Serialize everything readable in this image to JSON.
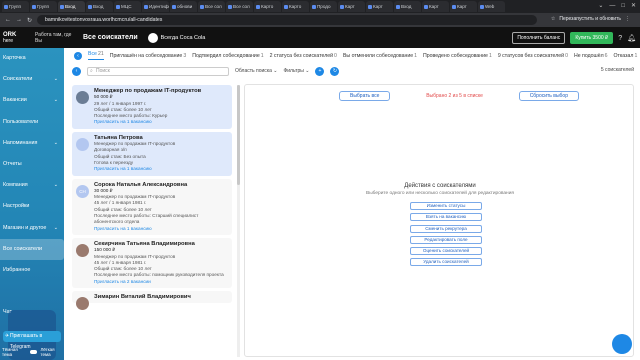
{
  "browser": {
    "tabs": [
      "Групп",
      "Групп",
      "Вход",
      "Вход",
      "МЦС",
      "Идентифи",
      "обнови",
      "Все сол",
      "Все сол",
      "Карто",
      "Карто",
      "Продо",
      "Карт",
      "Карт",
      "Вход",
      "Карт",
      "Карт",
      "Web"
    ],
    "url": "bamnikovitestonvosraua.worlhcmcru/all-candidates",
    "extension_text": "Перезапустить и обновить"
  },
  "appbar": {
    "logo": "ORK",
    "logo_sub": "here",
    "work_status": "Работа там, где Вы",
    "page_title": "Все соискатели",
    "company": "Всегда Coca Cola",
    "replenish": "Пополнить баланс",
    "buy": "Купить 3500 ₽"
  },
  "sidebar": {
    "items": [
      {
        "label": "Карточка",
        "chevron": ""
      },
      {
        "label": "Соискатели",
        "chevron": "⌄"
      },
      {
        "label": "Вакансии",
        "chevron": "⌄"
      },
      {
        "label": "Пользователи",
        "chevron": ""
      },
      {
        "label": "Напоминания",
        "chevron": "⌄"
      },
      {
        "label": "Отчеты",
        "chevron": ""
      },
      {
        "label": "Компания",
        "chevron": "⌄"
      },
      {
        "label": "Настройки",
        "chevron": ""
      },
      {
        "label": "Магазин и другое",
        "chevron": "⌄"
      },
      {
        "label": "Все соискатели",
        "chevron": ""
      },
      {
        "label": "Избранное",
        "chevron": ""
      },
      {
        "label": "",
        "chevron": ""
      },
      {
        "label": "Чат",
        "chevron": ""
      }
    ],
    "telegram": "Приглашать в Telegram",
    "toggle_left": "Тёмная тема",
    "toggle_right": "Лёгкая тема"
  },
  "stages": [
    {
      "label": "Все",
      "count": "21"
    },
    {
      "label": "Приглашён на собеседование",
      "count": "3"
    },
    {
      "label": "Подтвердил собеседование",
      "count": "1"
    },
    {
      "label": "2 статуса без соискателей",
      "count": "0"
    },
    {
      "label": "Вы отменили собеседование",
      "count": "1"
    },
    {
      "label": "Проведено собеседование",
      "count": "1"
    },
    {
      "label": "9 статусов без соискателей",
      "count": "0"
    },
    {
      "label": "Не подошёл",
      "count": "6"
    },
    {
      "label": "Отказал",
      "count": "1"
    }
  ],
  "filters": {
    "search_placeholder": "Поиск",
    "search_area": "Область поиска ⌄",
    "filters": "Фильтры ⌄",
    "count": "5 соискателей"
  },
  "candidates": [
    {
      "initials": "",
      "name": "Менеджер по продажам IT-продуктов",
      "salary": "50 000 ₽",
      "vacancy": "",
      "l1": "29 лет / 1 января 1997 г.",
      "l2": "Общий стаж: более 10 лет",
      "l3": "Последнее место работы: Курьер",
      "l4": "",
      "link": "Пригласить на 1 вакансию"
    },
    {
      "initials": "",
      "name": "Татьяна Петрова",
      "salary": "",
      "vacancy": "Менеджер по продажам IT-продуктов",
      "l1": "Договорная з/п",
      "l2": "Общий стаж: Без опыта",
      "l3": "Готова к переезду",
      "l4": "",
      "link": "Пригласить на 1 вакансию"
    },
    {
      "initials": "СН",
      "name": "Сорока Наталья Александровна",
      "salary": "30 000 ₽",
      "vacancy": "Менеджер по продажам IT-продуктов",
      "l1": "45 лет / 1 января 1981 г.",
      "l2": "Общий стаж: более 10 лет",
      "l3": "Последнее место работы: Старший специалист абонентского отдела",
      "l4": "",
      "link": "Пригласить на 1 вакансию"
    },
    {
      "initials": "",
      "name": "Секирчина Татьяна Владимировна",
      "salary": "150 000 ₽",
      "vacancy": "Менеджер по продажам IT-продуктов",
      "l1": "45 лет / 1 января 1981 г.",
      "l2": "Общий стаж: более 10 лет",
      "l3": "Последнее место работы: помощник руководителя проекта",
      "l4": "",
      "link": "Пригласить на 2 вакансии"
    },
    {
      "initials": "",
      "name": "Зимарин Виталий Владимирович",
      "salary": "",
      "vacancy": "",
      "l1": "",
      "l2": "",
      "l3": "",
      "l4": "",
      "link": ""
    }
  ],
  "selection": {
    "select_all": "Выбрать все",
    "selected": "Выбрано 2 из 5 в списке",
    "reset": "Сбросить выбор"
  },
  "actions": {
    "title": "Действия с соискателями",
    "subtitle": "Выберите одного или несколько соискателей для редактирования",
    "buttons": [
      "Изменить статусы",
      "Взять на вакансию",
      "Сменить рекрутера",
      "Редактировать поле",
      "Оценить соискателей",
      "Удалить соискателей"
    ]
  }
}
